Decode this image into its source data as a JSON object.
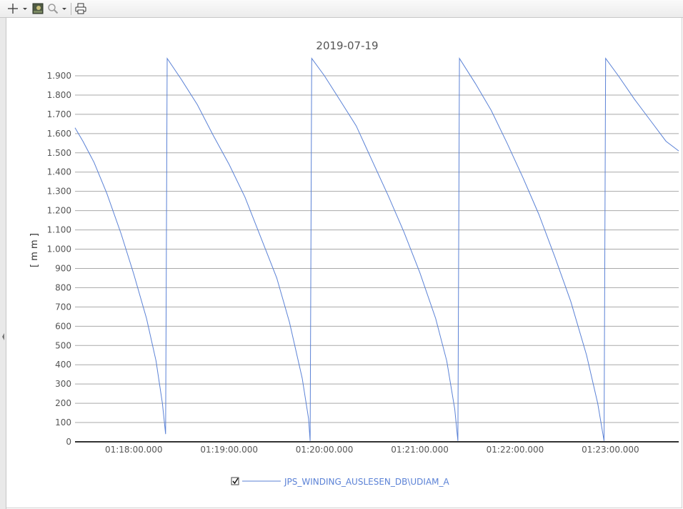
{
  "toolbar": {
    "icons": [
      "crosshair-icon",
      "dropdown-arrow-icon",
      "image-icon",
      "zoom-icon",
      "dropdown-arrow-icon",
      "print-icon"
    ]
  },
  "colors": {
    "series": "#5b82d6",
    "grid": "#a9a9a9",
    "axis": "#333333",
    "tick_text": "#555555",
    "legend_text": "#5b82d6"
  },
  "chart_data": {
    "type": "line",
    "title": "2019-07-19",
    "ylabel": "[ m m ]",
    "xlabel": "",
    "ylim": [
      0,
      1900
    ],
    "yticks": [
      0,
      100,
      200,
      300,
      400,
      500,
      600,
      700,
      800,
      900,
      1000,
      1100,
      1200,
      1300,
      1400,
      1500,
      1600,
      1700,
      1800,
      1900
    ],
    "ytick_labels": [
      "0",
      "100",
      "200",
      "300",
      "400",
      "500",
      "600",
      "700",
      "800",
      "900",
      "1.000",
      "1.100",
      "1.200",
      "1.300",
      "1.400",
      "1.500",
      "1.600",
      "1.700",
      "1.800",
      "1.900"
    ],
    "xlim": [
      "01:17:23",
      "01:23:43"
    ],
    "xtick_labels": [
      "01:18:00.000",
      "01:19:00.000",
      "01:20:00.000",
      "01:21:00.000",
      "01:22:00.000",
      "01:23:00.000"
    ],
    "grid": true,
    "legend_position": "bottom-center",
    "series": [
      {
        "name": "JPS_WINDING_AUSLESEN_DB\\UDIAM_A",
        "points": [
          [
            "01:17:23",
            1630
          ],
          [
            "01:17:28",
            1560
          ],
          [
            "01:17:35",
            1450
          ],
          [
            "01:17:43",
            1290
          ],
          [
            "01:17:52",
            1080
          ],
          [
            "01:18:00",
            870
          ],
          [
            "01:18:08",
            640
          ],
          [
            "01:18:14",
            420
          ],
          [
            "01:18:18",
            200
          ],
          [
            "01:18:20",
            40
          ],
          [
            "01:18:21",
            1990
          ],
          [
            "01:18:30",
            1880
          ],
          [
            "01:18:40",
            1750
          ],
          [
            "01:18:50",
            1590
          ],
          [
            "01:19:00",
            1440
          ],
          [
            "01:19:10",
            1270
          ],
          [
            "01:19:20",
            1060
          ],
          [
            "01:19:30",
            850
          ],
          [
            "01:19:38",
            620
          ],
          [
            "01:19:46",
            330
          ],
          [
            "01:19:50",
            120
          ],
          [
            "01:19:51",
            5
          ],
          [
            "01:19:52",
            1990
          ],
          [
            "01:20:00",
            1900
          ],
          [
            "01:20:10",
            1770
          ],
          [
            "01:20:20",
            1640
          ],
          [
            "01:20:30",
            1460
          ],
          [
            "01:20:40",
            1280
          ],
          [
            "01:20:50",
            1090
          ],
          [
            "01:21:00",
            880
          ],
          [
            "01:21:10",
            640
          ],
          [
            "01:21:17",
            420
          ],
          [
            "01:21:22",
            170
          ],
          [
            "01:21:24",
            5
          ],
          [
            "01:21:25",
            1990
          ],
          [
            "01:21:35",
            1860
          ],
          [
            "01:21:45",
            1720
          ],
          [
            "01:21:55",
            1550
          ],
          [
            "01:22:05",
            1370
          ],
          [
            "01:22:15",
            1180
          ],
          [
            "01:22:25",
            960
          ],
          [
            "01:22:35",
            730
          ],
          [
            "01:22:45",
            450
          ],
          [
            "01:22:52",
            200
          ],
          [
            "01:22:56",
            5
          ],
          [
            "01:22:57",
            1990
          ],
          [
            "01:23:05",
            1900
          ],
          [
            "01:23:15",
            1780
          ],
          [
            "01:23:25",
            1670
          ],
          [
            "01:23:35",
            1560
          ],
          [
            "01:23:43",
            1510
          ]
        ]
      }
    ]
  }
}
